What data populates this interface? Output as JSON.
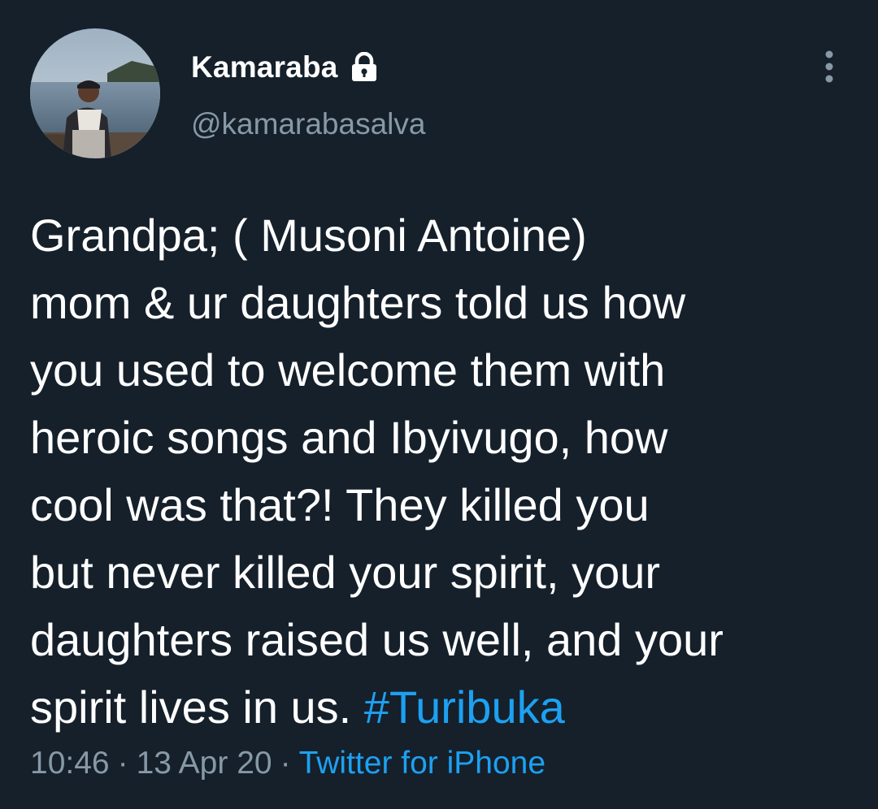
{
  "author": {
    "display_name": "Kamaraba",
    "handle": "@kamarabasalva",
    "protected_icon": "lock-icon"
  },
  "menu": {
    "icon": "more-vertical-icon"
  },
  "tweet": {
    "lines": [
      "Grandpa; ( Musoni Antoine)",
      "mom & ur daughters told us how",
      "you used to welcome them with",
      "heroic songs and Ibyivugo, how",
      "cool was that?! They killed you",
      "but never killed your spirit, your",
      "daughters raised us well, and your"
    ],
    "last_line_text": "spirit lives in us. ",
    "hashtag": "#Turibuka"
  },
  "meta": {
    "time": "10:46",
    "separator": "·",
    "date": "13 Apr 20",
    "source": "Twitter for iPhone"
  },
  "colors": {
    "background": "#15202b",
    "text": "#ffffff",
    "secondary": "#8899a6",
    "accent": "#1da1f2"
  }
}
